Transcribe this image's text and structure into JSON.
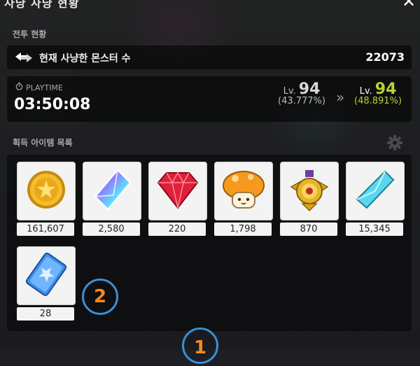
{
  "window": {
    "title": "사냥 사냥 현황",
    "close_symbol": "✕"
  },
  "battle": {
    "section_label": "전투 현황",
    "monster_label": "현재 사냥한 몬스터 수",
    "monster_count": "22073",
    "playtime_label": "PLAYTIME",
    "playtime_value": "03:50:08",
    "level_prefix": "Lv.",
    "level_before": "94",
    "percent_before": "(43.777%)",
    "arrow": "»",
    "level_after": "94",
    "percent_after": "(48.891%)"
  },
  "items": {
    "section_label": "획득 아이템 목록",
    "list": [
      {
        "icon": "gold-coin-icon",
        "count": "161,607"
      },
      {
        "icon": "rainbow-crystal-icon",
        "count": "2,580"
      },
      {
        "icon": "red-gem-icon",
        "count": "220"
      },
      {
        "icon": "orange-mushroom-icon",
        "count": "1,798"
      },
      {
        "icon": "gold-medal-icon",
        "count": "870"
      },
      {
        "icon": "blue-crystal-icon",
        "count": "15,345"
      },
      {
        "icon": "blue-ticket-icon",
        "count": "28"
      }
    ]
  },
  "markers": {
    "first": "1",
    "second": "2"
  },
  "colors": {
    "level_after": "#b4d433",
    "marker_ring": "#3a8fd6",
    "marker_text": "#f28a1e"
  }
}
